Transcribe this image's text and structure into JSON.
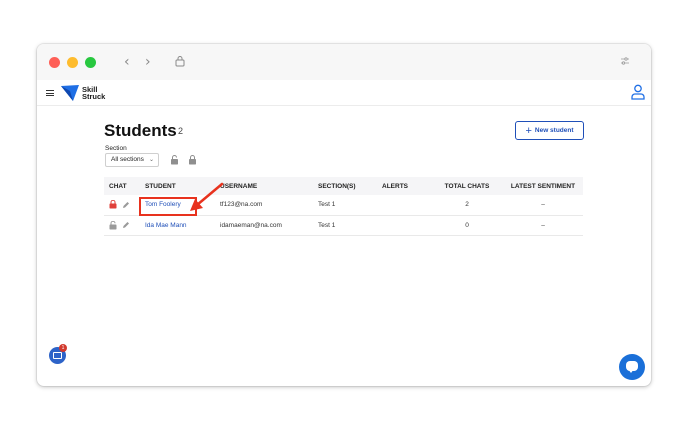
{
  "browser": {
    "back_icon": "chevron-left-icon",
    "forward_icon": "chevron-right-icon",
    "lock_icon": "lock-icon",
    "settings_icon": "sliders-icon",
    "back_glyph": "‹",
    "forward_glyph": "›"
  },
  "header": {
    "logo_line1": "Skill",
    "logo_line2": "Struck",
    "menu_icon": "hamburger-icon",
    "user_icon": "user-icon",
    "brand_color": "#1f6fe5"
  },
  "page": {
    "title": "Students",
    "count": "2",
    "new_button_label": "New student",
    "new_button_icon": "+"
  },
  "filters": {
    "section_label": "Section",
    "section_selected": "All sections"
  },
  "table": {
    "headers": {
      "chat": "CHAT",
      "student": "STUDENT",
      "username": "USERNAME",
      "sections": "SECTION(S)",
      "alerts": "ALERTS",
      "total_chats": "TOTAL CHATS",
      "latest_sentiment": "LATEST SENTIMENT"
    },
    "rows": [
      {
        "student": "Tom Foolery",
        "username": "tf123@na.com",
        "sections": "Test 1",
        "alerts": "",
        "total_chats": "2",
        "latest_sentiment": "–",
        "chat_lock_color": "#e0403a"
      },
      {
        "student": "Ida Mae Mann",
        "username": "idamaeman@na.com",
        "sections": "Test 1",
        "alerts": "",
        "total_chats": "0",
        "latest_sentiment": "–",
        "chat_lock_color": "#9a9a9a"
      }
    ]
  },
  "annotation": {
    "color": "#e8321e"
  },
  "widgets": {
    "notification_count": "1",
    "chat_fab_color": "#1a6fd8"
  }
}
